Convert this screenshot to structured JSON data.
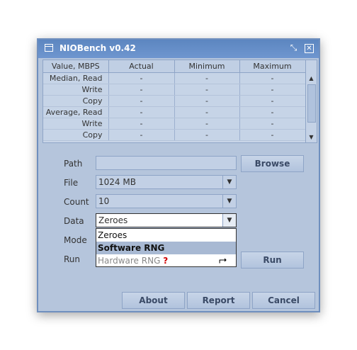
{
  "window": {
    "title": "NIOBench v0.42"
  },
  "table": {
    "headers": [
      "Value, MBPS",
      "Actual",
      "Minimum",
      "Maximum"
    ],
    "rows": [
      [
        "Median, Read",
        "-",
        "-",
        "-"
      ],
      [
        "Write",
        "-",
        "-",
        "-"
      ],
      [
        "Copy",
        "-",
        "-",
        "-"
      ],
      [
        "Average, Read",
        "-",
        "-",
        "-"
      ],
      [
        "Write",
        "-",
        "-",
        "-"
      ],
      [
        "Copy",
        "-",
        "-",
        "-"
      ]
    ]
  },
  "form": {
    "path_label": "Path",
    "path_value": "",
    "browse_label": "Browse",
    "file_label": "File",
    "file_value": "1024 MB",
    "count_label": "Count",
    "count_value": "10",
    "data_label": "Data",
    "data_value": "Zeroes",
    "data_options": [
      "Zeroes",
      "Software RNG",
      "Hardware RNG"
    ],
    "hardware_marker": "?",
    "mode_label": "Mode",
    "run_label": "Run",
    "run_button_label": "Run"
  },
  "footer": {
    "about_label": "About",
    "report_label": "Report",
    "cancel_label": "Cancel"
  }
}
